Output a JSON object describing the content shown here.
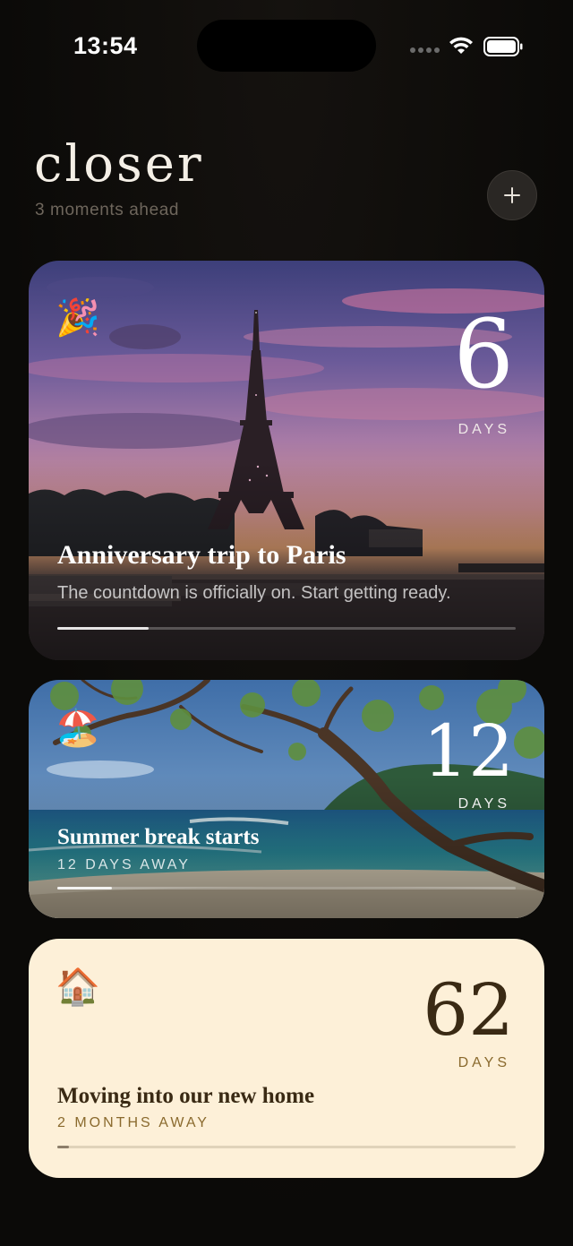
{
  "status": {
    "time": "13:54"
  },
  "header": {
    "title": "closer",
    "subtitle": "3 moments ahead",
    "add_icon": "plus-icon"
  },
  "cards": [
    {
      "emoji": "🎉",
      "number": "6",
      "unit": "DAYS",
      "title": "Anniversary trip to Paris",
      "subtitle": "The countdown is officially on. Start getting ready.",
      "progress": 0.2,
      "scene": "eiffel-tower-sunset"
    },
    {
      "emoji": "🏖️",
      "number": "12",
      "unit": "DAYS",
      "title": "Summer break starts",
      "subtitle": "12 DAYS AWAY",
      "progress": 0.12,
      "scene": "tropical-beach"
    },
    {
      "emoji": "🏠",
      "number": "62",
      "unit": "DAYS",
      "title": "Moving into our new home",
      "subtitle": "2 MONTHS AWAY",
      "progress": 0.025,
      "background": "#fdf0d8"
    }
  ],
  "colors": {
    "page_bg": "#0e0c0a",
    "cream_card": "#fdf0d8",
    "cream_text": "#3a2a14",
    "cream_accent": "#8a6a2e"
  }
}
